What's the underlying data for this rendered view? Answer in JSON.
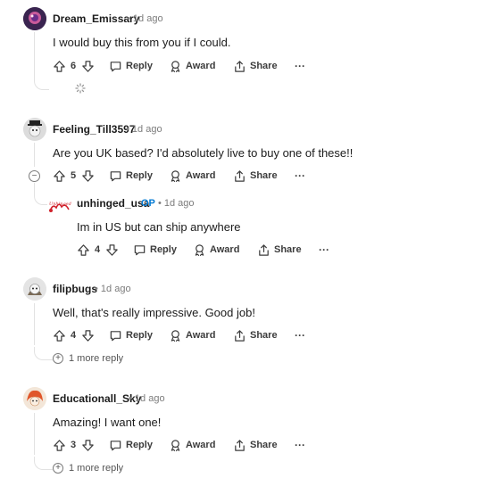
{
  "comments": [
    {
      "username": "Dream_Emissary",
      "time": "1d ago",
      "text": "I would buy this from you if I could.",
      "votes": "6",
      "reply": "Reply",
      "award": "Award",
      "share": "Share",
      "more": "···"
    },
    {
      "username": "Feeling_Till3597",
      "time": "1d ago",
      "text": "Are you UK based? I'd absolutely live to buy one of these!!",
      "votes": "5",
      "reply": "Reply",
      "award": "Award",
      "share": "Share",
      "more": "···",
      "collapse": "−"
    },
    {
      "username": "unhinged_usa",
      "badge": "OP",
      "time": "1d ago",
      "text": "Im in US but can ship anywhere",
      "votes": "4",
      "reply": "Reply",
      "award": "Award",
      "share": "Share",
      "more": "···",
      "avatar_text": "Unhinged"
    },
    {
      "username": "filipbugs",
      "time": "1d ago",
      "text": "Well, that's really impressive. Good job!",
      "votes": "4",
      "reply": "Reply",
      "award": "Award",
      "share": "Share",
      "more": "···",
      "more_replies": "1 more reply"
    },
    {
      "username": "Educationall_Sky",
      "time": "1d ago",
      "text": "Amazing! I want one!",
      "votes": "3",
      "reply": "Reply",
      "award": "Award",
      "share": "Share",
      "more": "···",
      "more_replies": "1 more reply"
    }
  ],
  "separator": "•",
  "colors": {
    "op": "#0079d3",
    "thread": "#e2e2e2",
    "text": "#1c1c1c",
    "meta": "#7c7c7c"
  }
}
